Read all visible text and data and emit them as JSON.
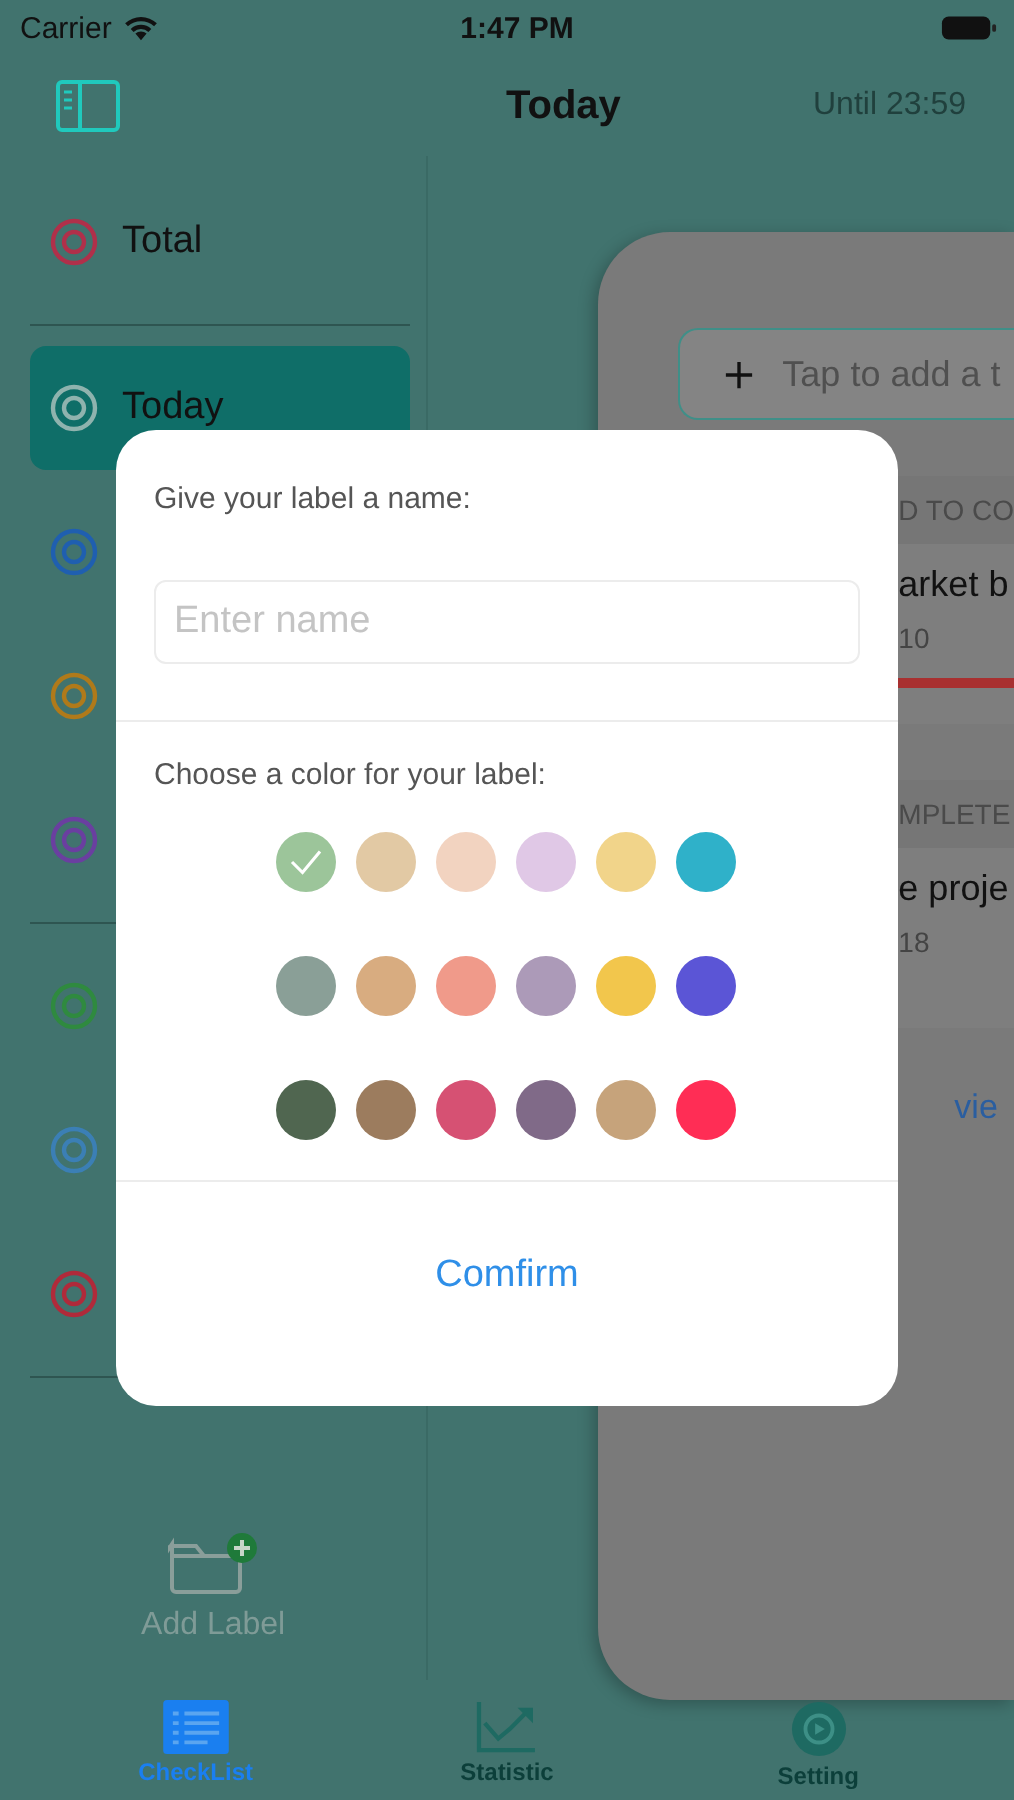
{
  "status_bar": {
    "carrier": "Carrier",
    "time": "1:47 PM"
  },
  "nav_bar": {
    "title": "Today",
    "deadline": "Until 23:59"
  },
  "sidebar": {
    "items": [
      {
        "label": "Total",
        "color": "#b0304a",
        "selected": false
      },
      {
        "label": "Today",
        "color": "#8fb3ae",
        "selected": true
      },
      {
        "color": "#1f5fb0",
        "selected": false
      },
      {
        "color": "#b07a1a",
        "selected": false
      },
      {
        "color": "#6a3fa0",
        "selected": false
      },
      {
        "color": "#2f8a3f",
        "selected": false
      },
      {
        "color": "#3b7fb5",
        "selected": false
      },
      {
        "color": "#b02a3a",
        "selected": false
      }
    ],
    "add_label": "Add Label"
  },
  "task_panel": {
    "add_field": {
      "placeholder": "Tap to add a t"
    },
    "sections": [
      {
        "header": "D TO CO",
        "tasks": [
          {
            "title": "arket b",
            "date": "10",
            "overdue": true
          }
        ]
      },
      {
        "header": "MPLETE",
        "tasks": [
          {
            "title": "e proje",
            "date": "18",
            "overdue": false
          }
        ]
      }
    ],
    "link": "vie"
  },
  "dialog": {
    "name_prompt": "Give your label a name:",
    "name_field": {
      "placeholder": "Enter name"
    },
    "color_prompt": "Choose a color for your label:",
    "swatches": [
      {
        "color": "#9cc59a",
        "selected": true
      },
      {
        "color": "#e2c9a4",
        "selected": false
      },
      {
        "color": "#f2d3c0",
        "selected": false
      },
      {
        "color": "#e0c8e6",
        "selected": false
      },
      {
        "color": "#f1d48a",
        "selected": false
      },
      {
        "color": "#2fb1c9",
        "selected": false
      },
      {
        "color": "#8a9f97",
        "selected": false
      },
      {
        "color": "#d8ac80",
        "selected": false
      },
      {
        "color": "#f09a8a",
        "selected": false
      },
      {
        "color": "#ac9ab8",
        "selected": false
      },
      {
        "color": "#f2c64c",
        "selected": false
      },
      {
        "color": "#5b55d6",
        "selected": false
      },
      {
        "color": "#506650",
        "selected": false
      },
      {
        "color": "#9c7c5e",
        "selected": false
      },
      {
        "color": "#d65173",
        "selected": false
      },
      {
        "color": "#806a88",
        "selected": false
      },
      {
        "color": "#c6a37b",
        "selected": false
      },
      {
        "color": "#ff2d55",
        "selected": false
      }
    ],
    "confirm": "Comfirm"
  },
  "tab_bar": [
    {
      "label": "CheckList",
      "selected": true
    },
    {
      "label": "Statistic",
      "selected": false
    },
    {
      "label": "Setting",
      "selected": false
    }
  ]
}
